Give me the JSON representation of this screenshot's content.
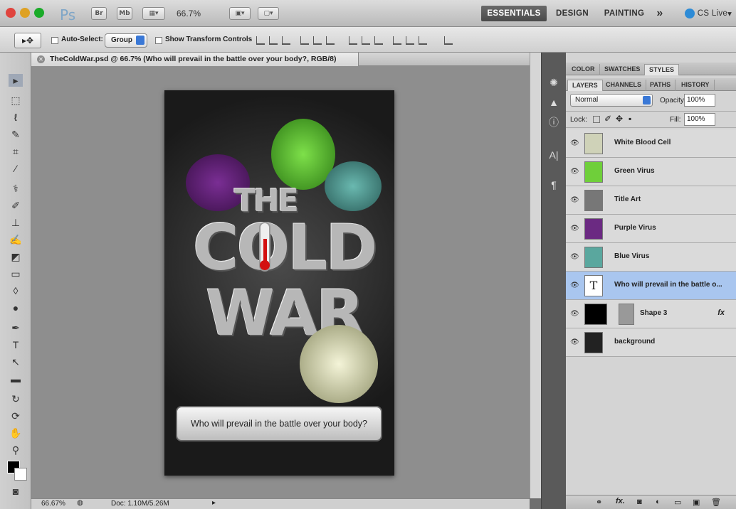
{
  "app": {
    "logo": "Ps",
    "bridge_label": "Br",
    "minibridge_label": "Mb",
    "zoom_level": "66.7%",
    "workspaces": [
      "ESSENTIALS",
      "DESIGN",
      "PAINTING"
    ],
    "more_label": "»",
    "cslive_label": "CS Live"
  },
  "options": {
    "auto_select_label": "Auto-Select:",
    "auto_select_value": "Group",
    "show_transform_label": "Show Transform Controls"
  },
  "document": {
    "tab_title": "TheColdWar.psd @ 66.7% (Who will prevail in the battle over your body?, RGB/8)",
    "art_title_the": "THE",
    "art_title_cold": "COLD",
    "art_title_war": "WAR",
    "caption": "Who will prevail in the battle over your body?"
  },
  "status": {
    "zoom": "66.67%",
    "doc": "Doc: 1.10M/5.26M"
  },
  "panels": {
    "top_tabs": [
      "COLOR",
      "SWATCHES",
      "STYLES"
    ],
    "layer_tabs": [
      "LAYERS",
      "CHANNELS",
      "PATHS",
      "HISTORY"
    ],
    "blend_mode": "Normal",
    "opacity_label": "Opacity:",
    "opacity_value": "100%",
    "lock_label": "Lock:",
    "fill_label": "Fill:",
    "fill_value": "100%",
    "layers": [
      {
        "name": "White Blood Cell"
      },
      {
        "name": "Green Virus"
      },
      {
        "name": "Title Art"
      },
      {
        "name": "Purple Virus"
      },
      {
        "name": "Blue Virus"
      },
      {
        "name": "Who will prevail in the battle o..."
      },
      {
        "name": "Shape 3"
      },
      {
        "name": "background"
      }
    ]
  },
  "colors": {
    "selection": "#a9c6ef",
    "traffic_red": "#e0443e",
    "traffic_yellow": "#dea123",
    "traffic_green": "#1aab29"
  }
}
